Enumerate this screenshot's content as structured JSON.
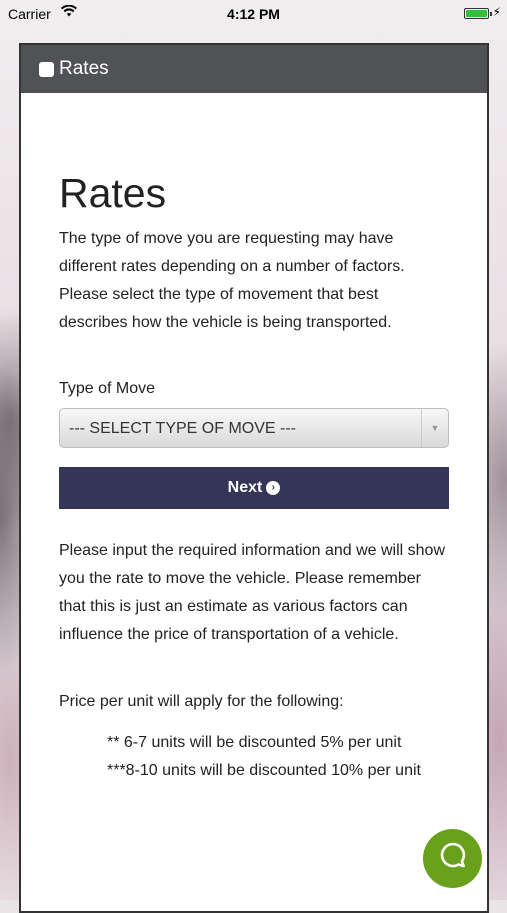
{
  "status_bar": {
    "carrier": "Carrier",
    "time": "4:12 PM"
  },
  "header": {
    "title": "Rates"
  },
  "page": {
    "heading": "Rates",
    "intro": "The type of move you are requesting may have different rates depending on a number of factors. Please select the type of movement that best describes how the vehicle is being transported.",
    "type_label": "Type of Move",
    "select_value": "--- SELECT TYPE OF MOVE ---",
    "next_label": "Next",
    "info": "Please input the required information and we will show you the rate to move the vehicle. Please remember that this is just an estimate as various factors can influence the price of transportation of a vehicle.",
    "price_per_unit": "Price per unit will apply for the following:",
    "discounts": [
      "** 6-7 units will be discounted 5% per unit",
      "***8-10 units will be discounted 10% per unit"
    ]
  },
  "icons": {
    "wifi": "wifi-icon",
    "battery": "battery-icon",
    "chat": "chat-icon",
    "next": "arrow-circle-right-icon"
  },
  "colors": {
    "header": "#515255",
    "button": "#353558",
    "chat": "#6aa11c"
  }
}
